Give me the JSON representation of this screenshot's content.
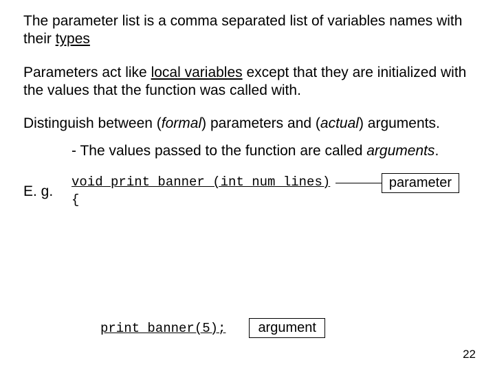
{
  "para1_a": "The parameter list is a comma separated list of variables names with their ",
  "para1_b": "types",
  "para2_a": "Parameters act like ",
  "para2_b": "local variables",
  "para2_c": " except that they are initialized with the values that the function was called with.",
  "para3_a": "Distinguish between (",
  "para3_b": "formal",
  "para3_c": ") ",
  "para3_d": "parameters",
  "para3_e": " and (",
  "para3_f": "actual",
  "para3_g": ") ",
  "para3_h": "arguments",
  "para3_i": ".",
  "eg_label": "E. g.",
  "sub_a": "- The values passed to the function are called ",
  "sub_b": "arguments",
  "sub_c": ".",
  "code_line1": "void print_banner (int num_lines)",
  "code_line2": "{",
  "param_box": "parameter",
  "arg_code": "print_banner(5);",
  "arg_box": "argument",
  "page_number": "22"
}
